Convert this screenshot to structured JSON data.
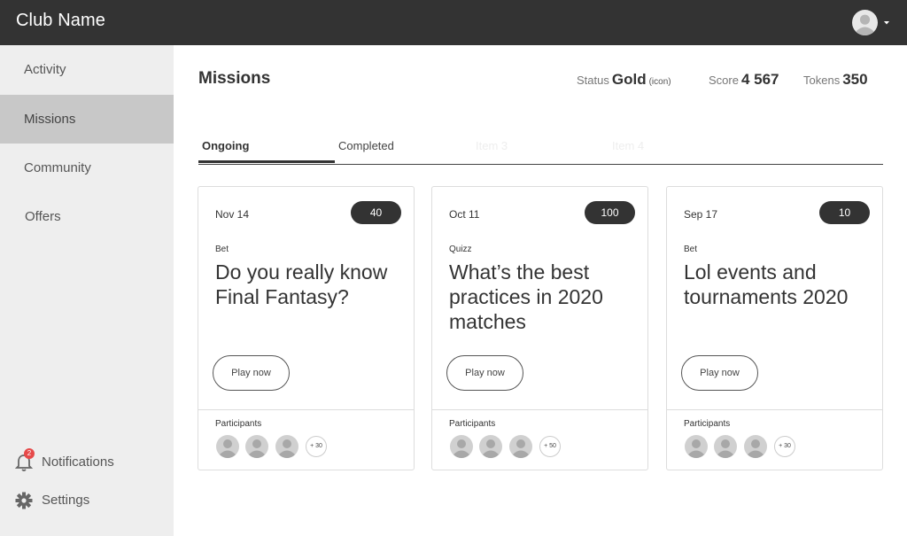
{
  "header": {
    "club_name": "Club Name"
  },
  "icons": {
    "user": "user-avatar-icon",
    "caret": "caret-down-icon",
    "bell": "bell-icon",
    "gear": "gear-icon",
    "participant": "participant-avatar-icon"
  },
  "colors": {
    "topbar": "#333333",
    "sidebar": "#eeeeee",
    "active_nav": "#c8c8c8",
    "badge": "#e64a4a"
  },
  "sidebar": {
    "items": [
      {
        "label": "Activity"
      },
      {
        "label": "Missions"
      },
      {
        "label": "Community"
      },
      {
        "label": "Offers"
      }
    ],
    "notifications": {
      "label": "Notifications",
      "count": "2"
    },
    "settings": {
      "label": "Settings"
    }
  },
  "main": {
    "title": "Missions",
    "status_label": "Status",
    "status_value": "Gold",
    "status_icon_text": "(icon)",
    "score_label": "Score",
    "score_value": "4 567",
    "tokens_label": "Tokens",
    "tokens_value": "350",
    "tabs": [
      {
        "label": "Ongoing"
      },
      {
        "label": "Completed"
      },
      {
        "label": "Item 3"
      },
      {
        "label": "Item 4"
      }
    ],
    "cards": [
      {
        "date": "Nov 14",
        "points": "40",
        "type": "Bet",
        "title": "Do you really know Final Fantasy?",
        "button": "Play now",
        "participants_label": "Participants",
        "more": "+ 30"
      },
      {
        "date": "Oct 11",
        "points": "100",
        "type": "Quizz",
        "title": "What’s the best practices in 2020 matches",
        "button": "Play now",
        "participants_label": "Participants",
        "more": "+ 50"
      },
      {
        "date": "Sep 17",
        "points": "10",
        "type": "Bet",
        "title": "Lol events and tournaments 2020",
        "button": "Play now",
        "participants_label": "Participants",
        "more": "+ 30"
      }
    ]
  }
}
